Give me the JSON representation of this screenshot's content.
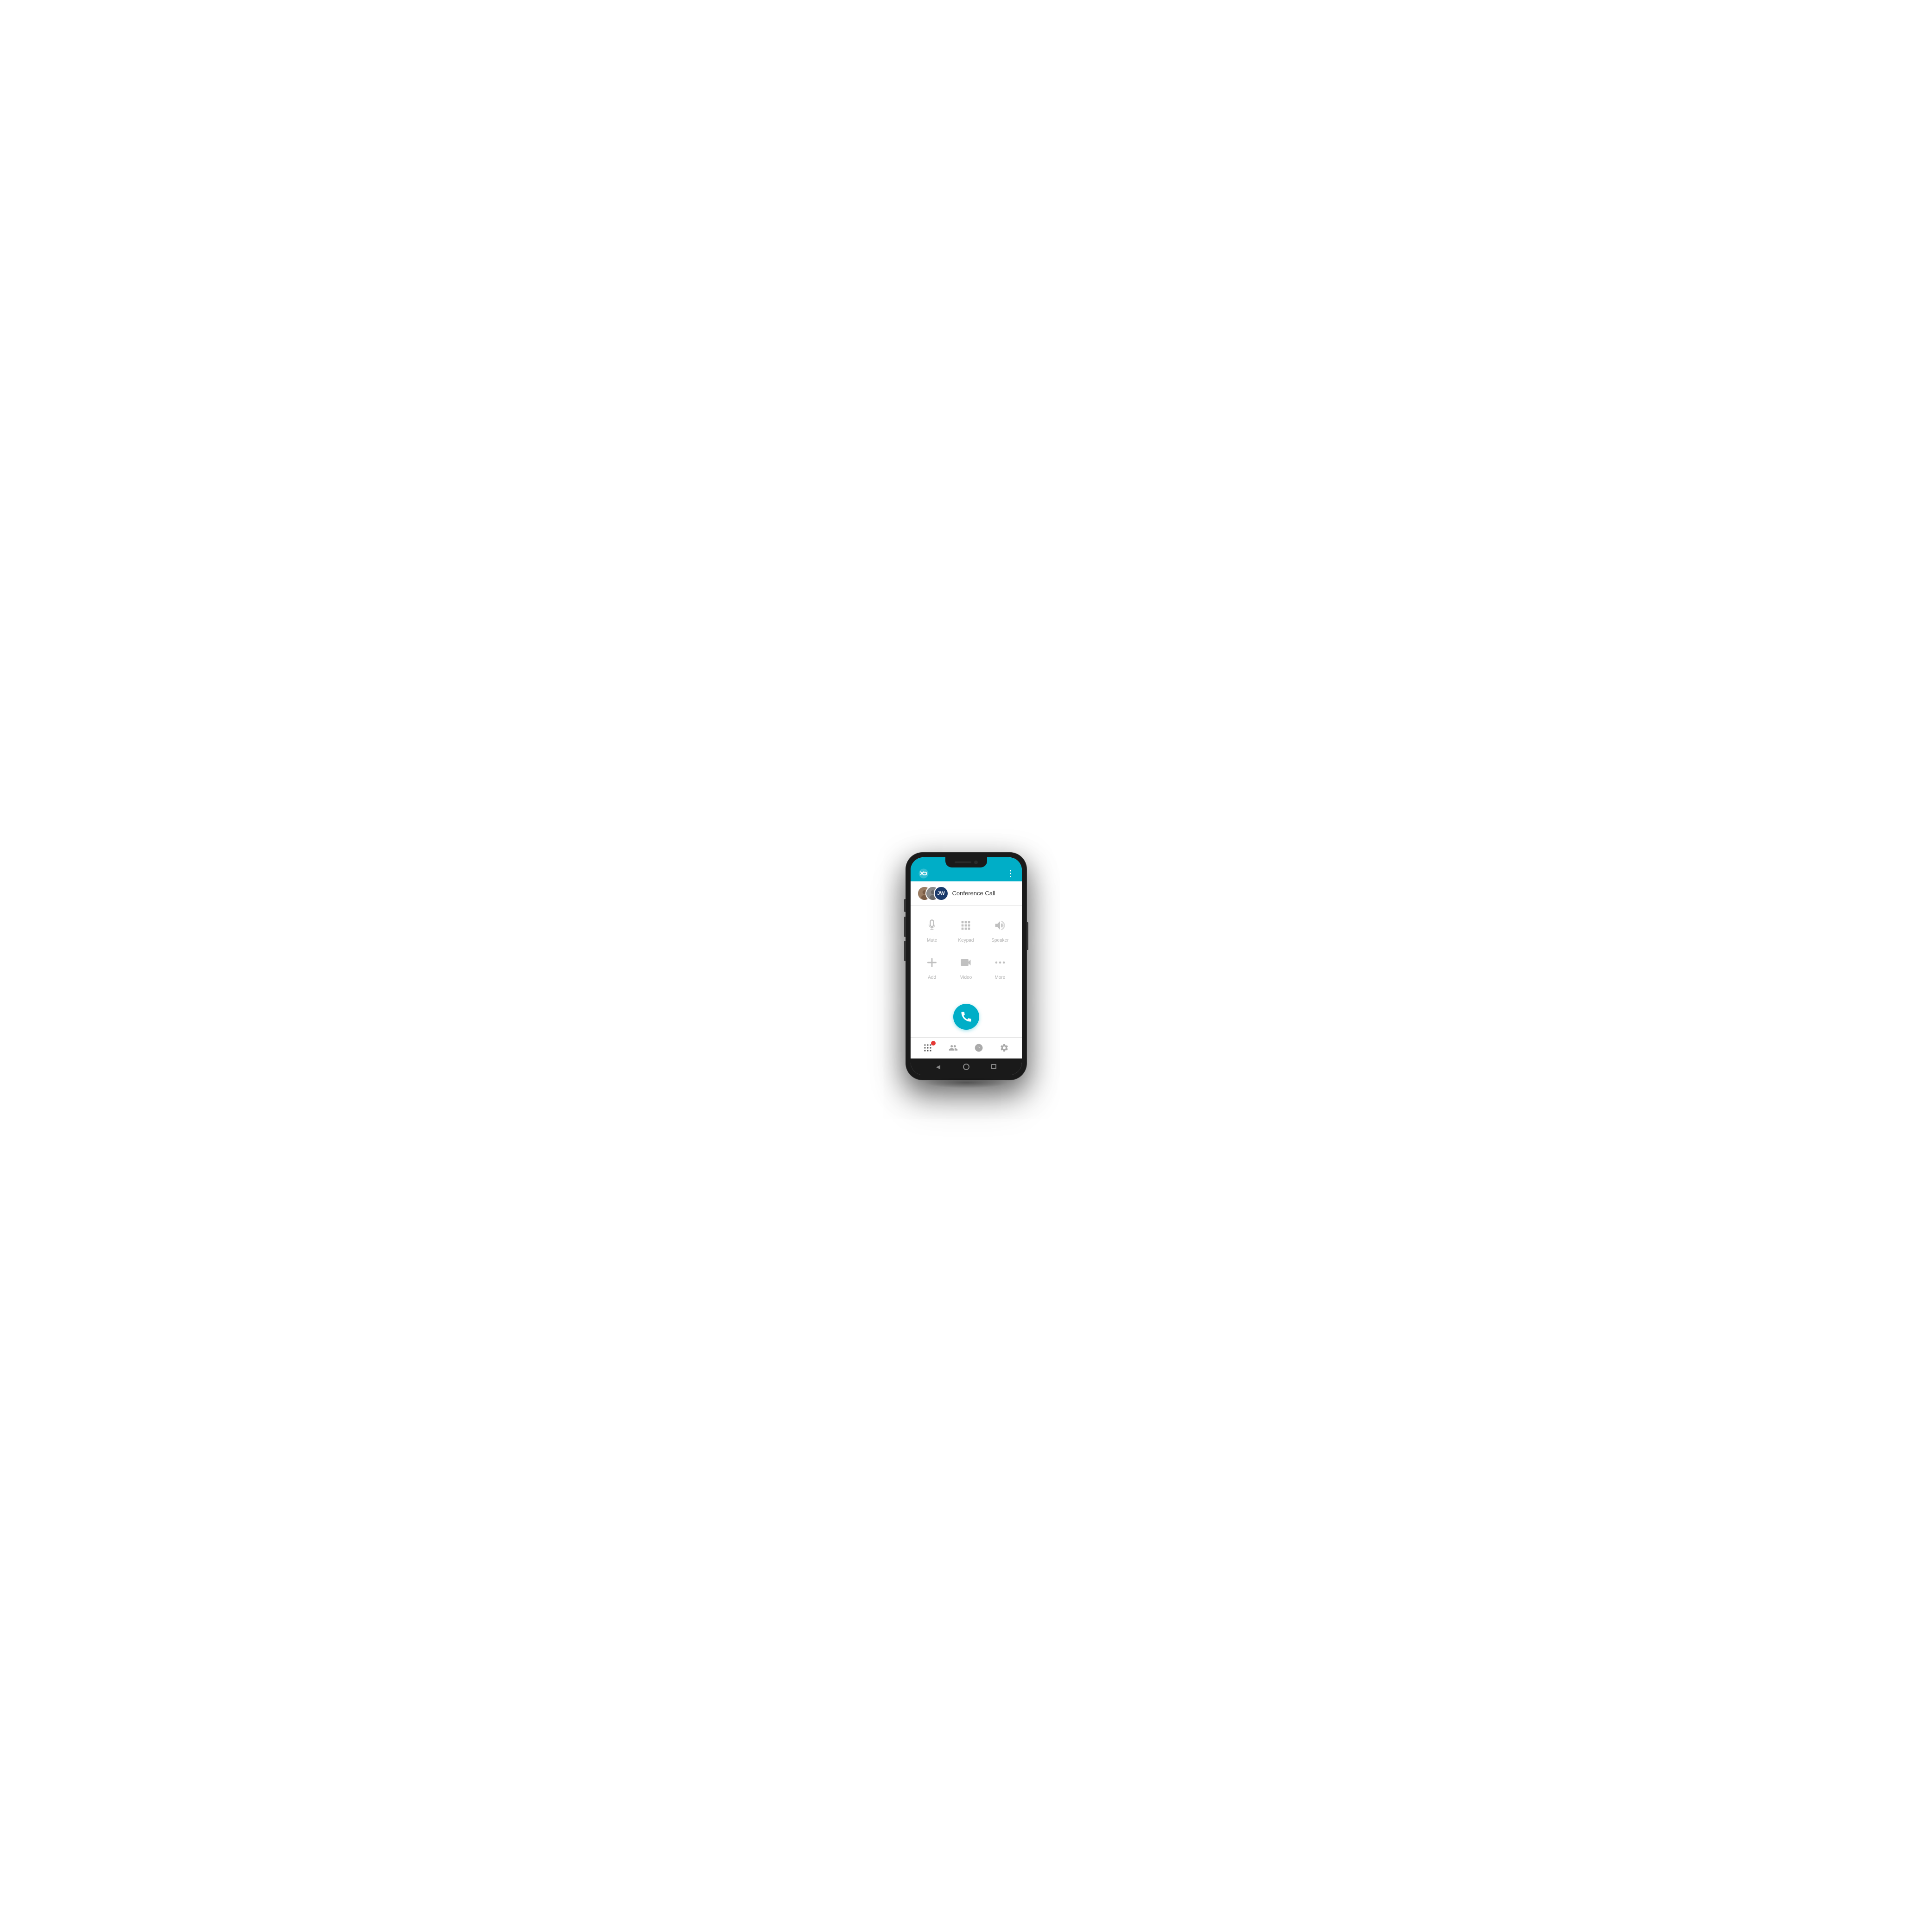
{
  "header": {
    "logo_alt": "XO Logo",
    "menu_icon": "⋮",
    "bg_color": "#00aec7"
  },
  "contact": {
    "name": "Conference Call",
    "avatars": [
      {
        "initials": "",
        "type": "photo",
        "color": "#a0856a"
      },
      {
        "initials": "",
        "type": "photo",
        "color": "#6B6B6B"
      },
      {
        "initials": "JW",
        "type": "initials",
        "color": "#1a3a6b"
      }
    ]
  },
  "controls": {
    "row1": [
      {
        "id": "mute",
        "label": "Mute"
      },
      {
        "id": "keypad",
        "label": "Keypad"
      },
      {
        "id": "speaker",
        "label": "Speaker"
      }
    ],
    "row2": [
      {
        "id": "add",
        "label": "Add"
      },
      {
        "id": "video",
        "label": "Video"
      },
      {
        "id": "more",
        "label": "More"
      }
    ]
  },
  "end_call": {
    "label": "End Call"
  },
  "bottom_nav": {
    "items": [
      {
        "id": "dialpad",
        "label": "",
        "has_badge": true
      },
      {
        "id": "contacts",
        "label": ""
      },
      {
        "id": "recents",
        "label": ""
      },
      {
        "id": "settings",
        "label": ""
      }
    ]
  },
  "android_nav": {
    "back": "◀",
    "home": "○",
    "recent": "■"
  }
}
